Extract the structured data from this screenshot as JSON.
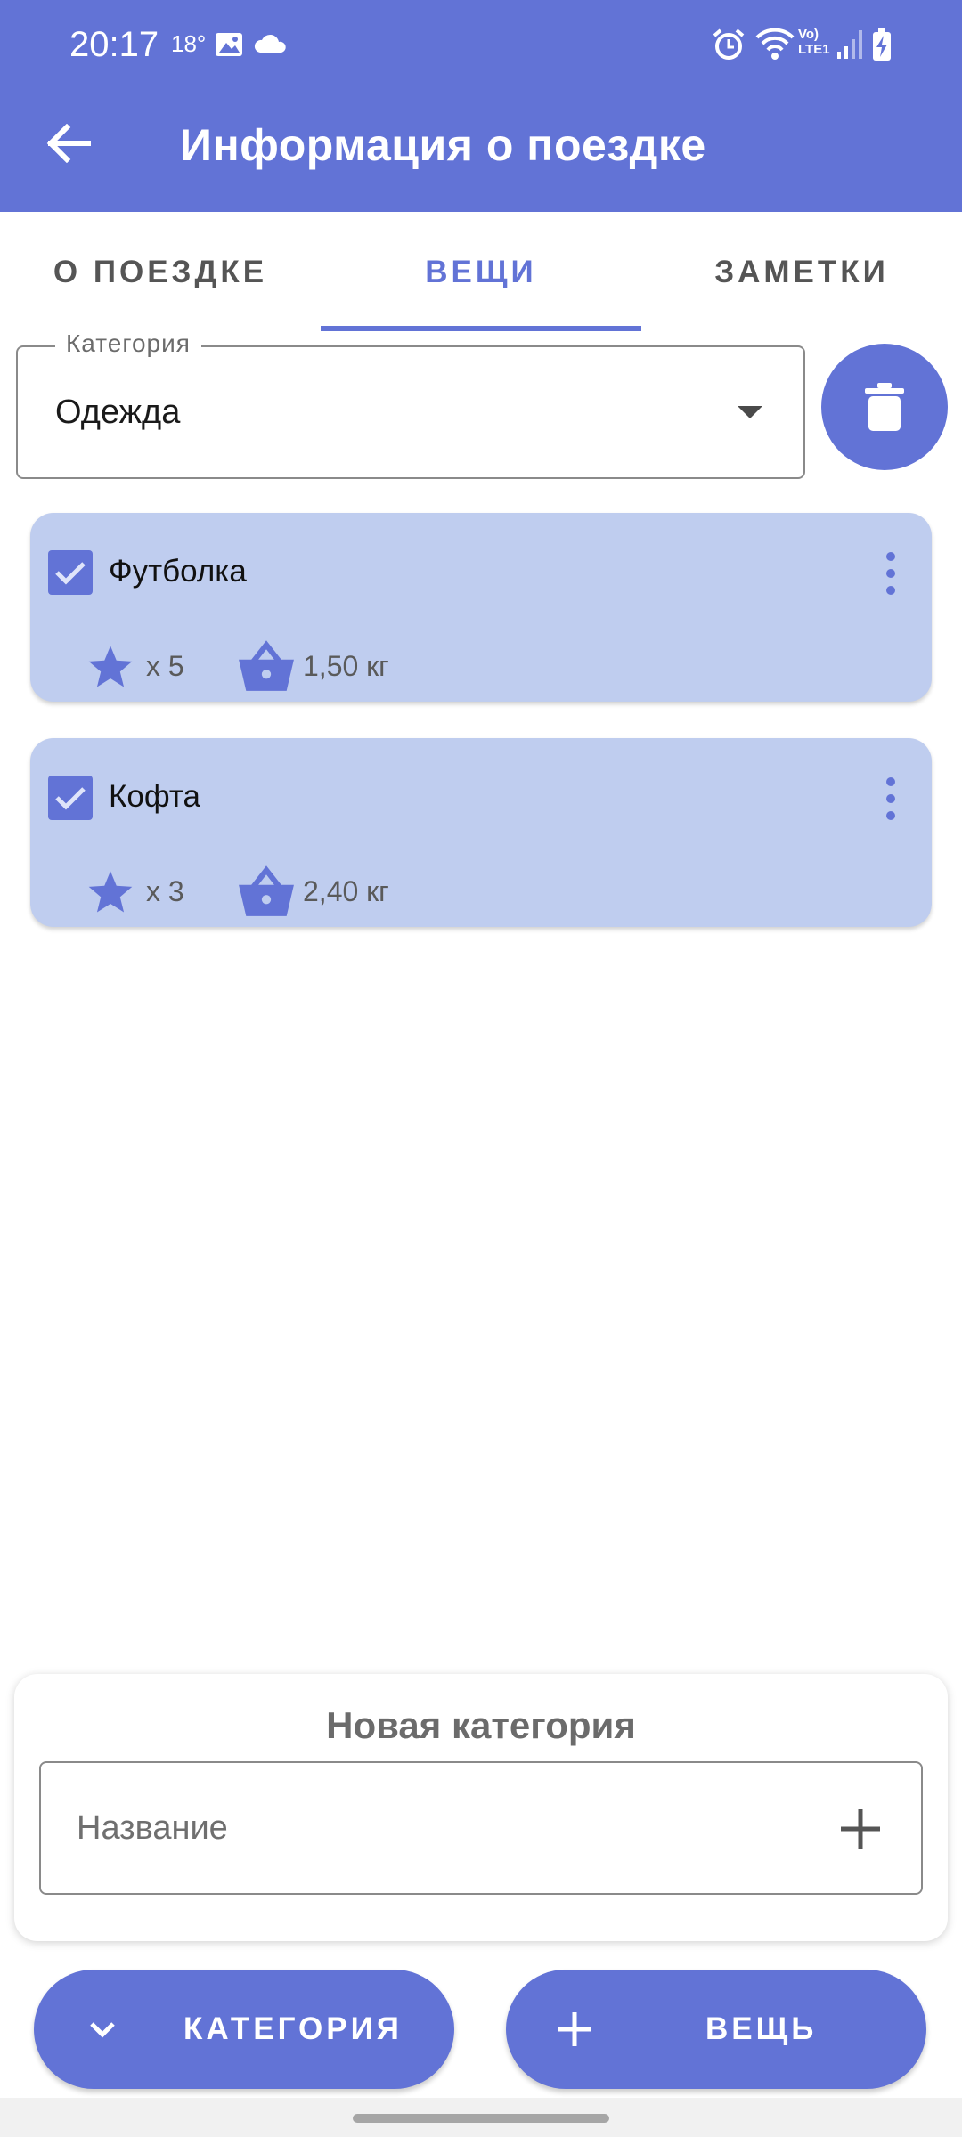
{
  "status_bar": {
    "time": "20:17",
    "temperature": "18°",
    "network_label": "Vo) LTE1"
  },
  "app_bar": {
    "title": "Информация о поездке",
    "back_icon": "arrow-left-icon",
    "color": "#6273d6"
  },
  "tabs": [
    {
      "label": "О ПОЕЗДКЕ",
      "active": false
    },
    {
      "label": "ВЕЩИ",
      "active": true
    },
    {
      "label": "ЗАМЕТКИ",
      "active": false
    }
  ],
  "category_field": {
    "label": "Категория",
    "value": "Одежда"
  },
  "delete_button": {
    "icon": "trash-icon"
  },
  "items": [
    {
      "name": "Футболка",
      "checked": true,
      "quantity": "x 5",
      "weight": "1,50 кг"
    },
    {
      "name": "Кофта",
      "checked": true,
      "quantity": "x 3",
      "weight": "2,40 кг"
    }
  ],
  "new_category": {
    "title": "Новая категория",
    "placeholder": "Название",
    "add_icon": "plus-icon"
  },
  "bottom_buttons": {
    "category": {
      "label": "КАТЕГОРИЯ",
      "icon": "chevron-down-icon"
    },
    "item": {
      "label": "ВЕЩЬ",
      "icon": "plus-icon"
    }
  },
  "colors": {
    "accent": "#6273d6",
    "card": "#bfcdef"
  }
}
